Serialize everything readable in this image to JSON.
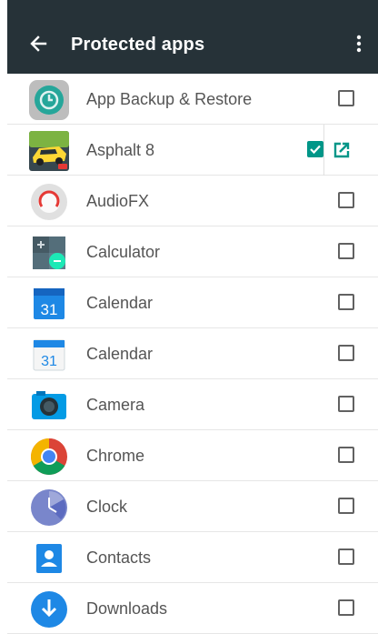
{
  "header": {
    "title": "Protected apps",
    "back_icon": "arrow-back-icon",
    "menu_icon": "more-vert-icon"
  },
  "colors": {
    "toolbar": "#263238",
    "accent": "#009688",
    "text": "#555555",
    "checkbox_border": "#616161"
  },
  "apps": [
    {
      "label": "App Backup & Restore",
      "icon": "app-backup-restore-icon",
      "checked": false
    },
    {
      "label": "Asphalt 8",
      "icon": "asphalt-8-icon",
      "checked": true,
      "launch_icon": "open-in-new-icon"
    },
    {
      "label": "AudioFX",
      "icon": "audiofx-icon",
      "checked": false
    },
    {
      "label": "Calculator",
      "icon": "calculator-icon",
      "checked": false
    },
    {
      "label": "Calendar",
      "icon": "calendar-icon",
      "checked": false,
      "date": "31"
    },
    {
      "label": "Calendar",
      "icon": "calendar-icon",
      "checked": false,
      "date": "31"
    },
    {
      "label": "Camera",
      "icon": "camera-icon",
      "checked": false
    },
    {
      "label": "Chrome",
      "icon": "chrome-icon",
      "checked": false
    },
    {
      "label": "Clock",
      "icon": "clock-icon",
      "checked": false
    },
    {
      "label": "Contacts",
      "icon": "contacts-icon",
      "checked": false
    },
    {
      "label": "Downloads",
      "icon": "downloads-icon",
      "checked": false
    }
  ]
}
